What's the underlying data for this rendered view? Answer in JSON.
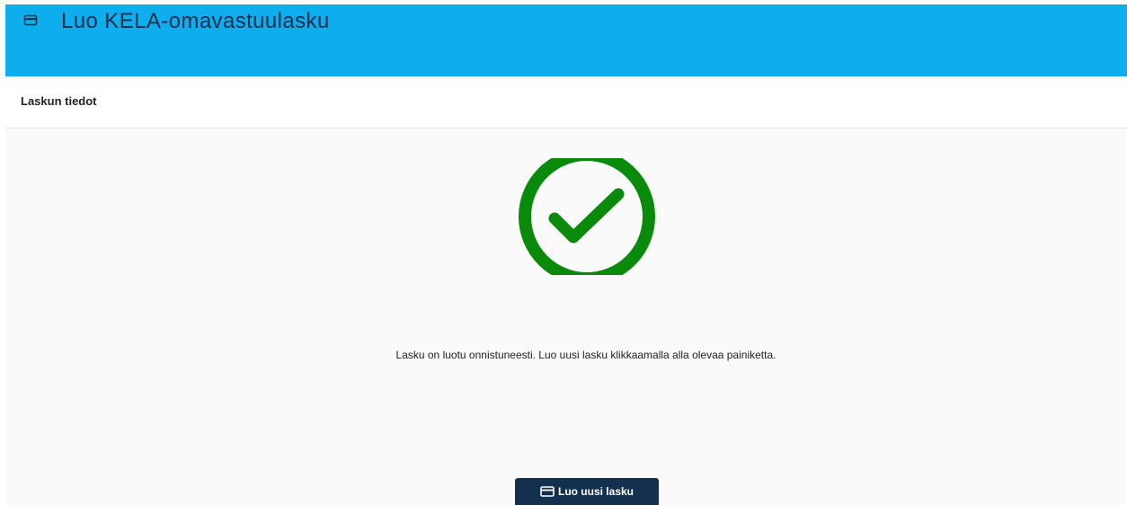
{
  "header": {
    "title": "Luo KELA-omavastuulasku",
    "icon": "credit-card-icon",
    "background": "#0eaeee",
    "title_color": "#1b2d4a"
  },
  "section": {
    "title": "Laskun tiedot"
  },
  "status": {
    "icon": "check-circle-icon",
    "color": "#0a8a0a",
    "message": "Lasku on luotu onnistuneesti. Luo uusi lasku klikkaamalla alla olevaa painiketta."
  },
  "actions": {
    "new_invoice_label": "Luo uusi lasku",
    "new_invoice_icon": "credit-card-icon",
    "button_color": "#14304f"
  }
}
